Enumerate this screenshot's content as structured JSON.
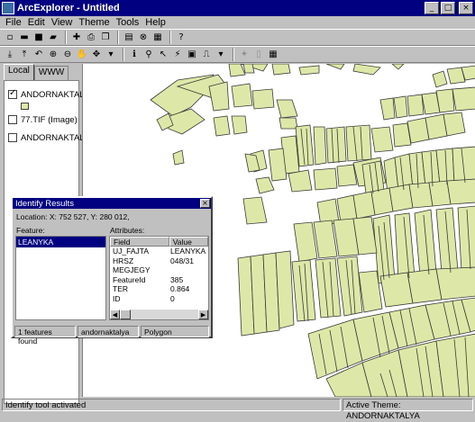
{
  "window": {
    "title": "ArcExplorer - Untitled",
    "minimize_glyph": "_",
    "maximize_glyph": "□",
    "close_glyph": "×"
  },
  "menu": [
    "File",
    "Edit",
    "View",
    "Theme",
    "Tools",
    "Help"
  ],
  "toolbar1_icons": [
    "new-icon",
    "open-icon",
    "save-icon",
    "open-folder-icon",
    "add-theme-icon",
    "print-icon",
    "copy-icon",
    "layout-icon",
    "delete-icon",
    "properties-icon",
    "help-icon"
  ],
  "toolbar2_icons": [
    "zoom-extent-icon",
    "zoom-active-icon",
    "undo-icon",
    "zoom-in-icon",
    "zoom-out-icon",
    "pan-icon",
    "pan-direction-icon",
    "identify-icon",
    "find-icon",
    "measure-icon",
    "hotlink-icon",
    "select-icon",
    "query-icon",
    "clear-selection-icon",
    "properties-icon"
  ],
  "left_panel": {
    "tabs": [
      "Local",
      "WWW"
    ],
    "layers": [
      {
        "name": "ANDORNAKTALY",
        "checked": true
      },
      {
        "name": "77.TIF (Image)",
        "checked": false
      },
      {
        "name": "ANDORNAKTALY",
        "checked": false
      }
    ],
    "swatch_color": "#dde8a8"
  },
  "map": {
    "fill_color": "#dde8a8",
    "stroke_color": "#3a3a3a"
  },
  "identify_dialog": {
    "title": "Identify Results",
    "close_glyph": "×",
    "location_label": "Location: X: 752 527,  Y: 280 012,",
    "feature_label": "Feature:",
    "attributes_label": "Attributes:",
    "features": [
      "LEANYKA"
    ],
    "columns": [
      "Field",
      "Value"
    ],
    "rows": [
      {
        "field": "UJ_FAJTA",
        "value": "LEANYKA"
      },
      {
        "field": "HRSZ",
        "value": "048/31"
      },
      {
        "field": "MEGJEGY",
        "value": ""
      },
      {
        "field": "FeatureId",
        "value": "385"
      },
      {
        "field": "TER",
        "value": "0.864"
      },
      {
        "field": "ID",
        "value": "0"
      }
    ],
    "status": [
      "1  features found",
      "andornaktalya",
      "Polygon"
    ]
  },
  "statusbar": {
    "message": "Identify tool activated",
    "active_theme": "Active Theme: ANDORNAKTALYA"
  }
}
